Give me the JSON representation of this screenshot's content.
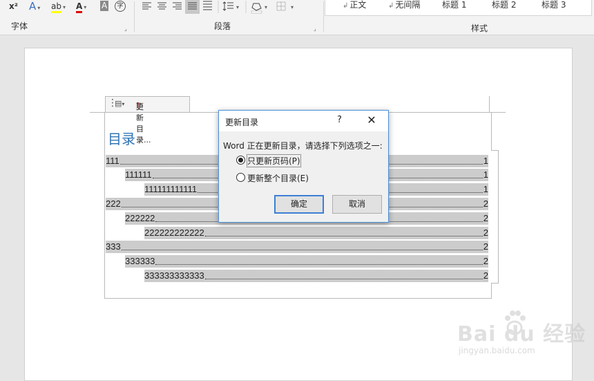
{
  "ribbon": {
    "font_group": {
      "label": "字体",
      "superscript": "x²",
      "text_effects": "A",
      "highlight": "ab",
      "font_color": "A",
      "char_shading": "A",
      "enclose_char": "字"
    },
    "paragraph_group": {
      "label": "段落"
    },
    "styles_group": {
      "label": "样式",
      "items": [
        "正文",
        "无间隔",
        "标题 1",
        "标题 2",
        "标题 3"
      ]
    }
  },
  "document": {
    "content_control": {
      "update_label": "更新目录..."
    },
    "toc": {
      "title": "目录",
      "entries": [
        {
          "text": "111",
          "page": "1",
          "level": 1
        },
        {
          "text": "111111",
          "page": "1",
          "level": 2
        },
        {
          "text": "111111111111",
          "page": "1",
          "level": 3
        },
        {
          "text": "222",
          "page": "2",
          "level": 1
        },
        {
          "text": "222222",
          "page": "2",
          "level": 2
        },
        {
          "text": "222222222222",
          "page": "2",
          "level": 3
        },
        {
          "text": "333",
          "page": "2",
          "level": 1
        },
        {
          "text": "333333",
          "page": "2",
          "level": 2
        },
        {
          "text": "333333333333",
          "page": "2",
          "level": 3
        }
      ]
    }
  },
  "dialog": {
    "title": "更新目录",
    "help": "?",
    "close": "✕",
    "prompt": "Word 正在更新目录，请选择下列选项之一:",
    "options": [
      {
        "label": "只更新页码(P)",
        "selected": true
      },
      {
        "label": "更新整个目录(E)",
        "selected": false
      }
    ],
    "ok_label": "确定",
    "cancel_label": "取消"
  },
  "watermark": {
    "logo": "Bai du 经验",
    "url": "jingyan.baidu.com"
  }
}
